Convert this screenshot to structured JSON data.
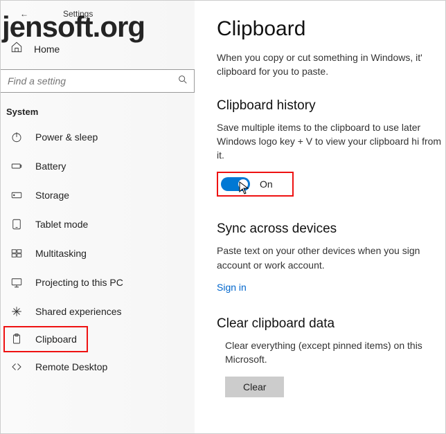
{
  "watermark": "jensoft.org",
  "window": {
    "back": "←",
    "title": "Settings"
  },
  "home": {
    "label": "Home"
  },
  "search": {
    "placeholder": "Find a setting"
  },
  "section_header": "System",
  "nav": [
    {
      "label": "Power & sleep"
    },
    {
      "label": "Battery"
    },
    {
      "label": "Storage"
    },
    {
      "label": "Tablet mode"
    },
    {
      "label": "Multitasking"
    },
    {
      "label": "Projecting to this PC"
    },
    {
      "label": "Shared experiences"
    },
    {
      "label": "Clipboard"
    },
    {
      "label": "Remote Desktop"
    }
  ],
  "page": {
    "title": "Clipboard",
    "intro": "When you copy or cut something in Windows, it' clipboard for you to paste.",
    "history": {
      "heading": "Clipboard history",
      "desc": "Save multiple items to the clipboard to use later Windows logo key + V to view your clipboard hi from it.",
      "toggle_state": "On"
    },
    "sync": {
      "heading": "Sync across devices",
      "desc": "Paste text on your other devices when you sign account or work account.",
      "link": "Sign in"
    },
    "clear": {
      "heading": "Clear clipboard data",
      "desc": "Clear everything (except pinned items) on this Microsoft.",
      "button": "Clear"
    }
  }
}
